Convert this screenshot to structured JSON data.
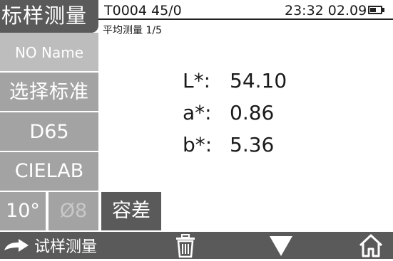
{
  "header": {
    "title": "标样测量",
    "status_id": "T0004 45/0",
    "status_time": "23:32 02.09",
    "battery_level": 0.6,
    "mode": "平均测量 1/5"
  },
  "sidebar": {
    "name": "NO Name",
    "select_standard": "选择标准",
    "illuminant": "D65",
    "color_space": "CIELAB",
    "observer_angle": "10°",
    "aperture": "Ø8",
    "tolerance": "容差"
  },
  "results": {
    "L_label": "L*:",
    "L_value": "54.10",
    "a_label": "a*:",
    "a_value": "0.86",
    "b_label": "b*:",
    "b_value": "5.36"
  },
  "bottom_bar": {
    "sample_label": "试样测量",
    "icons": [
      "arrow-right-icon",
      "trash-icon",
      "down-triangle-icon",
      "home-icon"
    ]
  },
  "colors": {
    "dark_gray": "#5a5a5a",
    "mid_gray": "#a3a3a3",
    "light_gray": "#bdbdbd"
  }
}
